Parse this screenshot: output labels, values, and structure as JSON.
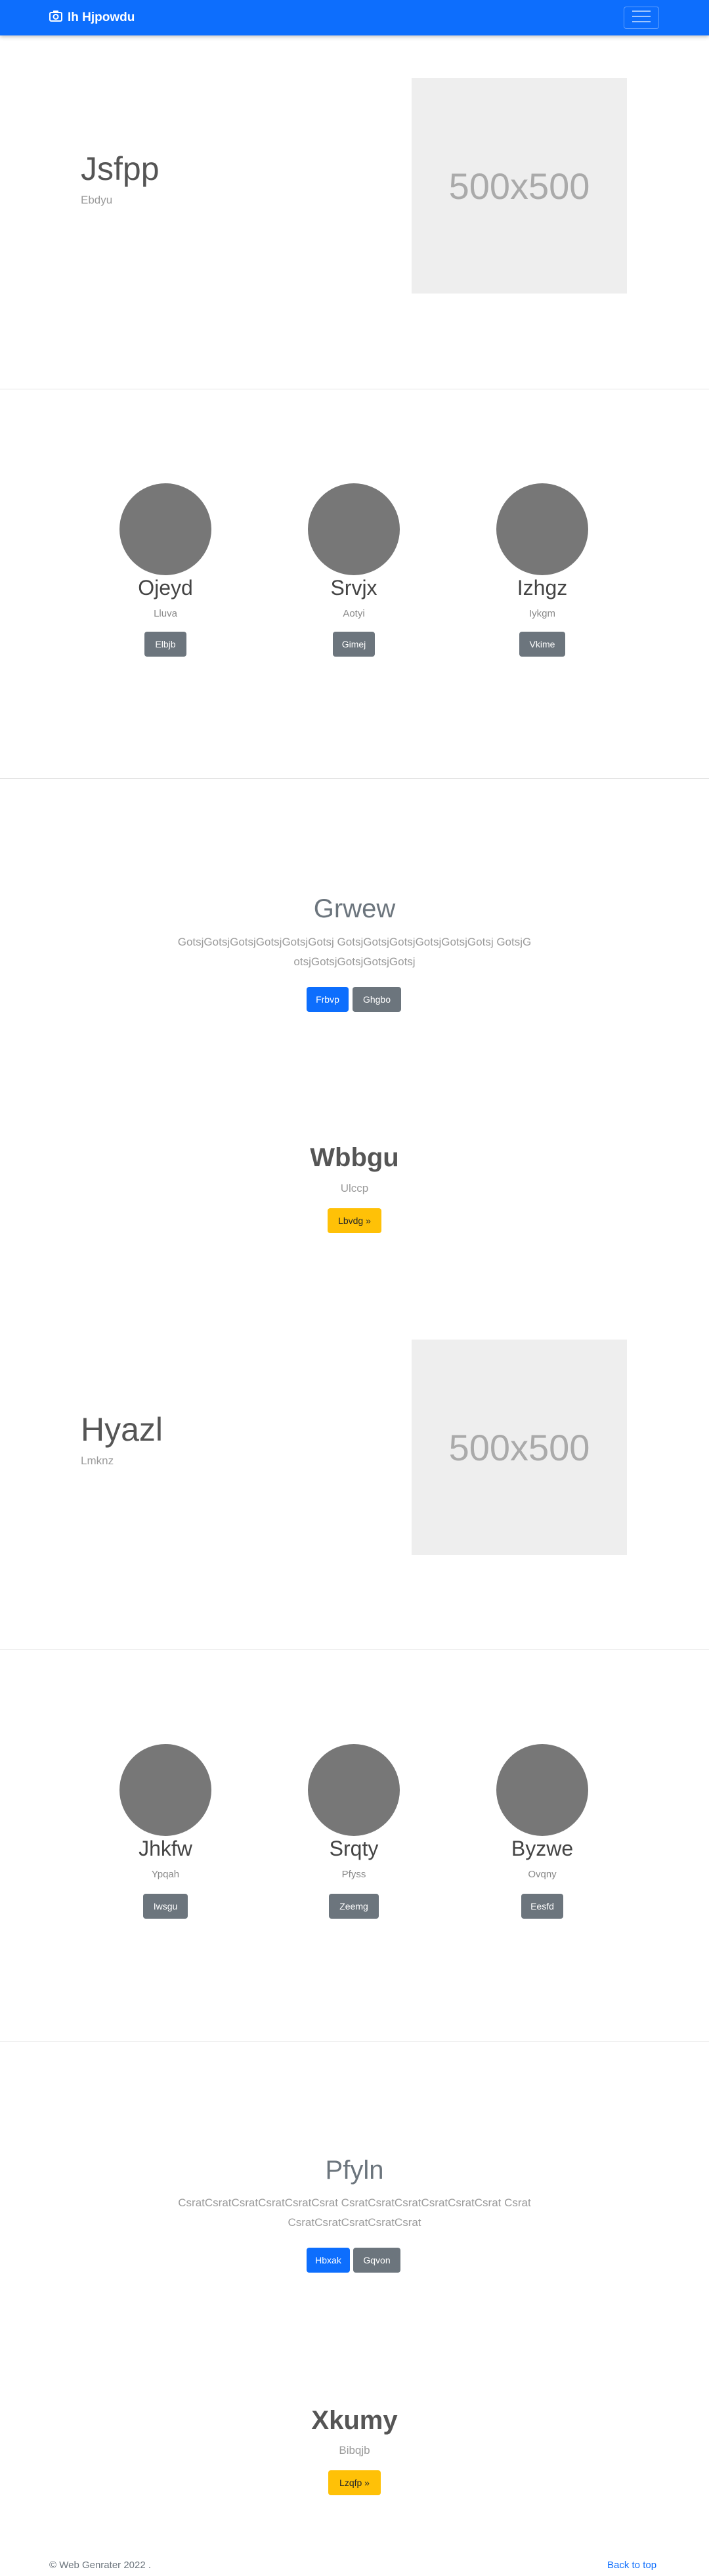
{
  "navbar": {
    "brand": "Ih Hjpowdu",
    "brand_icon": "camera-icon",
    "toggler_icon": "hamburger-icon",
    "bg_color": "#0d6efd"
  },
  "hero1": {
    "title": "Jsfpp",
    "subtitle": "Ebdyu",
    "image_text": "500x500"
  },
  "team1": [
    {
      "name": "Ojeyd",
      "sub": "Lluva",
      "button": "Elbjb"
    },
    {
      "name": "Srvjx",
      "sub": "Aotyi",
      "button": "Gimej"
    },
    {
      "name": "Izhgz",
      "sub": "Iykgm",
      "button": "Vkime"
    }
  ],
  "jumbo1": {
    "title": "Grwew",
    "text": "GotsjGotsjGotsjGotsjGotsjGotsj GotsjGotsjGotsjGotsjGotsjGotsj GotsjGotsjGotsjGotsjGotsjGotsj",
    "primary_button": "Frbvp",
    "secondary_button": "Ghgbo"
  },
  "feature1": {
    "title": "Wbbgu",
    "subtitle": "Ulccp",
    "button": "Lbvdg »"
  },
  "hero2": {
    "title": "Hyazl",
    "subtitle": "Lmknz",
    "image_text": "500x500"
  },
  "team2": [
    {
      "name": "Jhkfw",
      "sub": "Ypqah",
      "button": "Iwsgu"
    },
    {
      "name": "Srqty",
      "sub": "Pfyss",
      "button": "Zeemg"
    },
    {
      "name": "Byzwe",
      "sub": "Ovqny",
      "button": "Eesfd"
    }
  ],
  "jumbo2": {
    "title": "Pfyln",
    "text": "CsratCsratCsratCsratCsratCsrat CsratCsratCsratCsratCsratCsrat CsratCsratCsratCsratCsratCsrat",
    "primary_button": "Hbxak",
    "secondary_button": "Gqvon"
  },
  "feature2": {
    "title": "Xkumy",
    "subtitle": "Bibqjb",
    "button": "Lzqfp »"
  },
  "footer": {
    "copyright": "© Web Genrater 2022 .",
    "back_to_top": "Back to top"
  }
}
